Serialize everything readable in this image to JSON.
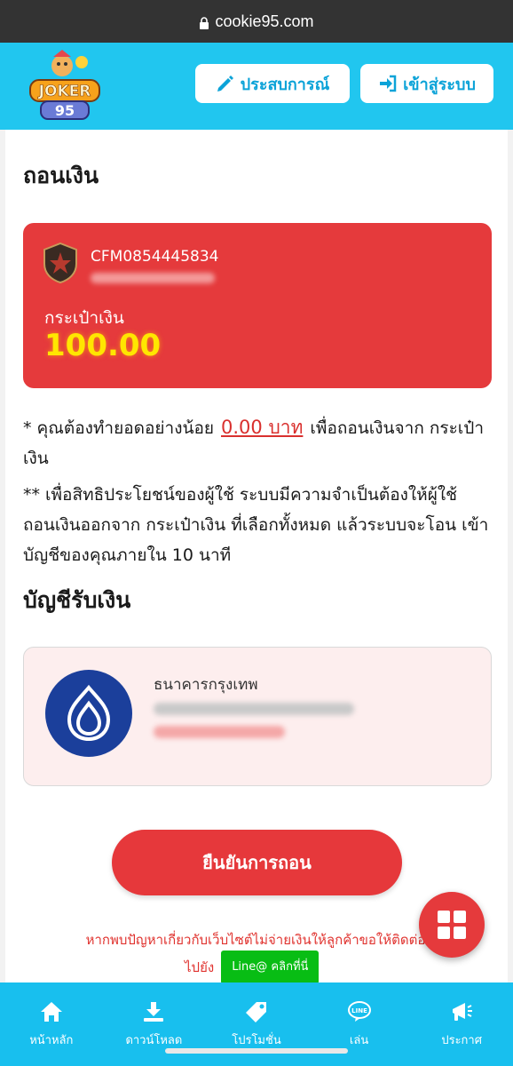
{
  "browser": {
    "url": "cookie95.com"
  },
  "header": {
    "logo_text": "JOKER95",
    "experience_label": "ประสบการณ์",
    "login_label": "เข้าสู่ระบบ"
  },
  "page": {
    "title": "ถอนเงิน"
  },
  "wallet": {
    "account_id": "CFM0854445834",
    "label": "กระเป๋าเงิน",
    "amount": "100.00"
  },
  "notes": {
    "note1_prefix": "* คุณต้องทำยอดอย่างน้อย",
    "note1_amount": "0.00 บาท",
    "note1_suffix": "เพื่อถอนเงินจาก กระเป๋าเงิน",
    "note2": "** เพื่อสิทธิประโยชน์ของผู้ใช้ ระบบมีความจำเป็นต้องให้ผู้ใช้ ถอนเงินออกจาก กระเป๋าเงิน ที่เลือกทั้งหมด แล้วระบบจะโอน เข้าบัญชีของคุณภายใน 10 นาที"
  },
  "receiving": {
    "title": "บัญชีรับเงิน",
    "bank_name": "ธนาคารกรุงเทพ"
  },
  "confirm_label": "ยืนยันการถอน",
  "warning": {
    "text": "หากพบปัญหาเกี่ยวกับเว็บไซต์ไม่จ่ายเงินให้ลูกค้าขอให้ติดต่อ",
    "to": "ไปยัง",
    "line_button": "Line@ คลิกที่นี่"
  },
  "bottom_nav": [
    {
      "label": "หน้าหลัก",
      "icon": "home-icon"
    },
    {
      "label": "ดาวน์โหลด",
      "icon": "download-icon"
    },
    {
      "label": "โปรโมชั่น",
      "icon": "tag-icon"
    },
    {
      "label": "เล่น",
      "icon": "line-icon"
    },
    {
      "label": "ประกาศ",
      "icon": "megaphone-icon"
    }
  ],
  "colors": {
    "header": "#21c6ef",
    "wallet_bg": "#e53a3c",
    "amount": "#ffe600",
    "bank": "#1b3f9b",
    "line_green": "#08bd14"
  }
}
